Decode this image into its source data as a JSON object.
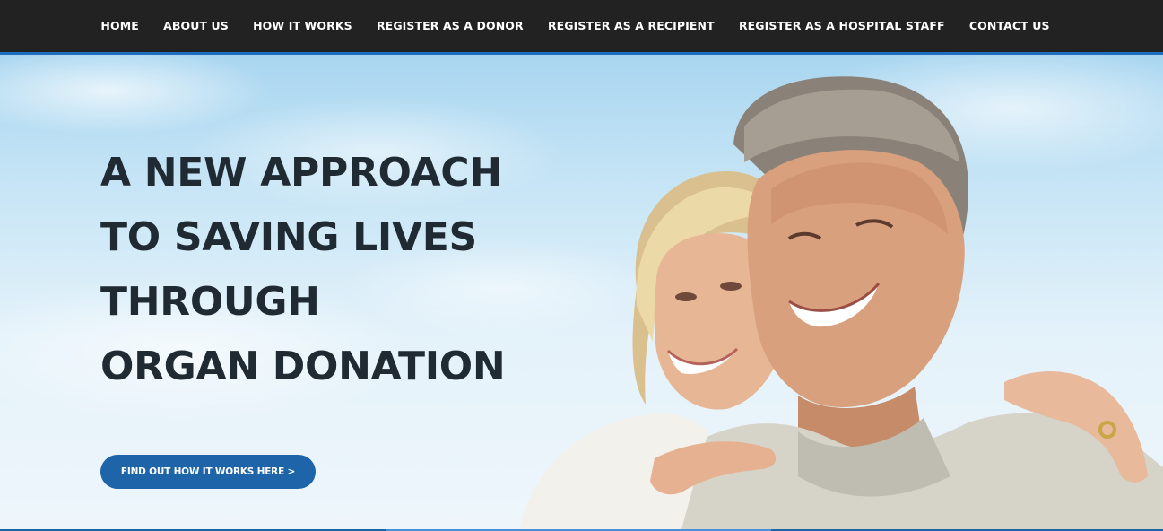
{
  "nav": {
    "items": [
      {
        "label": "HOME"
      },
      {
        "label": "ABOUT US"
      },
      {
        "label": "HOW IT WORKS"
      },
      {
        "label": "REGISTER AS A DONOR"
      },
      {
        "label": "REGISTER AS A RECIPIENT"
      },
      {
        "label": "REGISTER AS A HOSPITAL STAFF"
      },
      {
        "label": "CONTACT US"
      }
    ]
  },
  "hero": {
    "title_lines": [
      "A NEW APPROACH",
      "TO SAVING LIVES",
      "THROUGH",
      "ORGAN DONATION"
    ],
    "cta_label": "FIND OUT HOW IT WORKS HERE >",
    "photo_subject": "smiling-couple-photo"
  },
  "colors": {
    "navbar_bg": "#222222",
    "accent": "#1e6fc0",
    "button_bg": "#1e64a8",
    "title_text": "#1f2a33"
  }
}
